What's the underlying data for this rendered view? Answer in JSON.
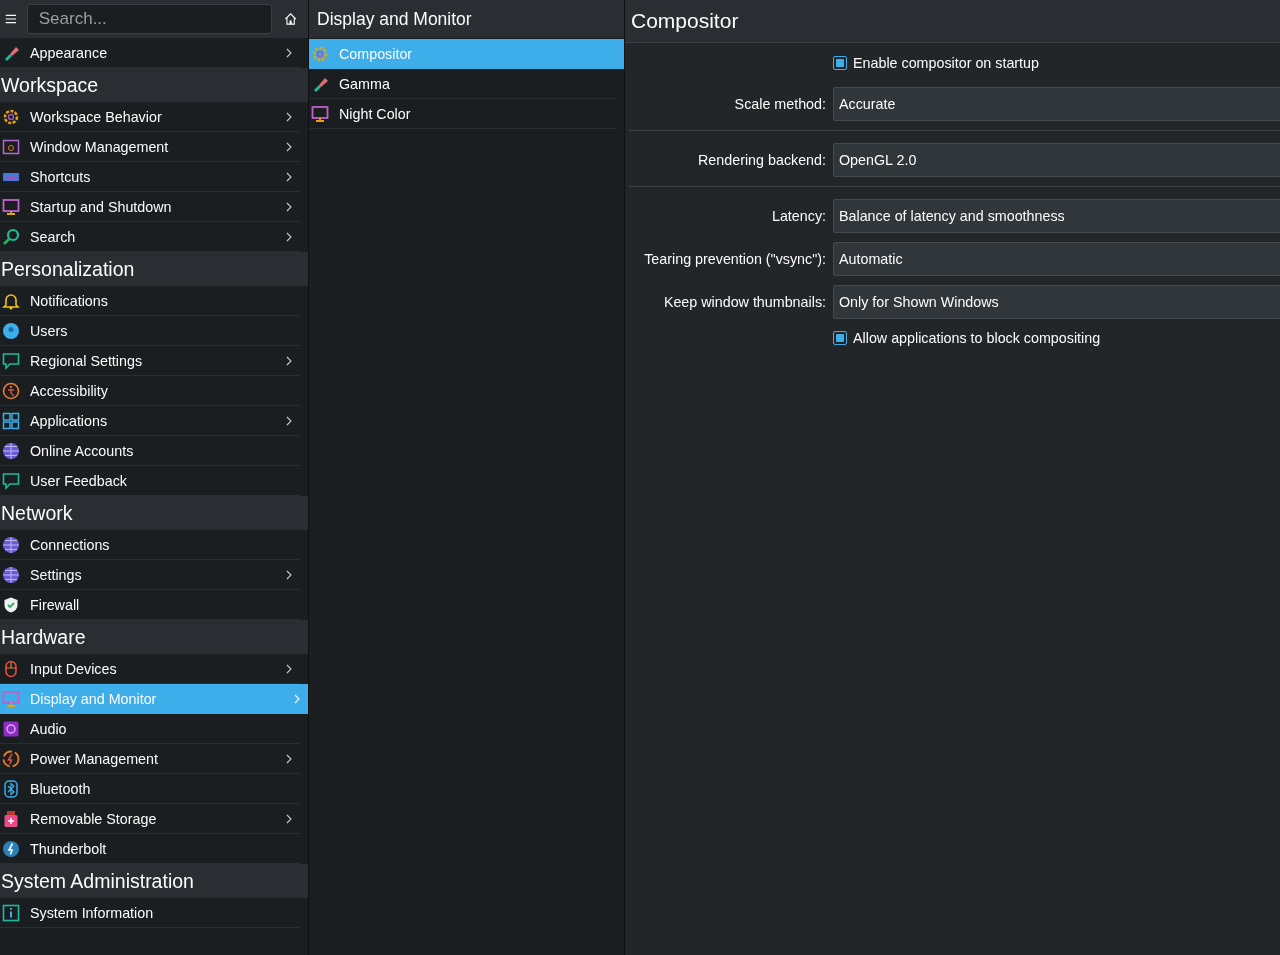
{
  "sidebar": {
    "search": {
      "placeholder": "Search..."
    },
    "top_items": [
      {
        "label": "Appearance",
        "kind": "brush",
        "has_children": true,
        "selected": false
      }
    ],
    "sections": [
      {
        "title": "Workspace",
        "items": [
          {
            "label": "Workspace Behavior",
            "kind": "gear",
            "has_children": true,
            "selected": false
          },
          {
            "label": "Window Management",
            "kind": "window",
            "has_children": true,
            "selected": false
          },
          {
            "label": "Shortcuts",
            "kind": "keyboard",
            "has_children": true,
            "selected": false
          },
          {
            "label": "Startup and Shutdown",
            "kind": "monitor",
            "has_children": true,
            "selected": false
          },
          {
            "label": "Search",
            "kind": "search",
            "has_children": true,
            "selected": false
          }
        ]
      },
      {
        "title": "Personalization",
        "items": [
          {
            "label": "Notifications",
            "kind": "bell",
            "has_children": false,
            "selected": false
          },
          {
            "label": "Users",
            "kind": "user",
            "has_children": false,
            "selected": false
          },
          {
            "label": "Regional Settings",
            "kind": "chat",
            "has_children": true,
            "selected": false
          },
          {
            "label": "Accessibility",
            "kind": "access",
            "has_children": false,
            "selected": false
          },
          {
            "label": "Applications",
            "kind": "grid",
            "has_children": true,
            "selected": false
          },
          {
            "label": "Online Accounts",
            "kind": "globe",
            "has_children": false,
            "selected": false
          },
          {
            "label": "User Feedback",
            "kind": "chat",
            "has_children": false,
            "selected": false
          }
        ]
      },
      {
        "title": "Network",
        "items": [
          {
            "label": "Connections",
            "kind": "globe",
            "has_children": false,
            "selected": false
          },
          {
            "label": "Settings",
            "kind": "globe",
            "has_children": true,
            "selected": false
          },
          {
            "label": "Firewall",
            "kind": "shield",
            "has_children": false,
            "selected": false
          }
        ]
      },
      {
        "title": "Hardware",
        "items": [
          {
            "label": "Input Devices",
            "kind": "mouse",
            "has_children": true,
            "selected": false
          },
          {
            "label": "Display and Monitor",
            "kind": "monitor",
            "has_children": true,
            "selected": true
          },
          {
            "label": "Audio",
            "kind": "audio",
            "has_children": false,
            "selected": false
          },
          {
            "label": "Power Management",
            "kind": "power",
            "has_children": true,
            "selected": false
          },
          {
            "label": "Bluetooth",
            "kind": "bluetooth",
            "has_children": false,
            "selected": false
          },
          {
            "label": "Removable Storage",
            "kind": "storage",
            "has_children": true,
            "selected": false
          },
          {
            "label": "Thunderbolt",
            "kind": "bolt",
            "has_children": false,
            "selected": false
          }
        ]
      },
      {
        "title": "System Administration",
        "items": [
          {
            "label": "System Information",
            "kind": "info",
            "has_children": false,
            "selected": false
          }
        ]
      }
    ]
  },
  "subpanel": {
    "title": "Display and Monitor",
    "items": [
      {
        "label": "Compositor",
        "kind": "gear",
        "selected": true
      },
      {
        "label": "Gamma",
        "kind": "brush",
        "selected": false
      },
      {
        "label": "Night Color",
        "kind": "monitor",
        "selected": false
      }
    ]
  },
  "content": {
    "title": "Compositor",
    "rows": [
      {
        "kind": "checkbox",
        "label": "Enable compositor on startup",
        "checked": true
      },
      {
        "kind": "select",
        "label": "Scale method:",
        "value": "Accurate"
      },
      {
        "kind": "separator"
      },
      {
        "kind": "select",
        "label": "Rendering backend:",
        "value": "OpenGL 2.0"
      },
      {
        "kind": "separator"
      },
      {
        "kind": "select",
        "label": "Latency:",
        "value": "Balance of latency and smoothness"
      },
      {
        "kind": "select",
        "label": "Tearing prevention (\"vsync\"):",
        "value": "Automatic"
      },
      {
        "kind": "select",
        "label": "Keep window thumbnails:",
        "value": "Only for Shown Windows"
      },
      {
        "kind": "checkbox",
        "label": "Allow applications to block compositing",
        "checked": true
      }
    ]
  }
}
